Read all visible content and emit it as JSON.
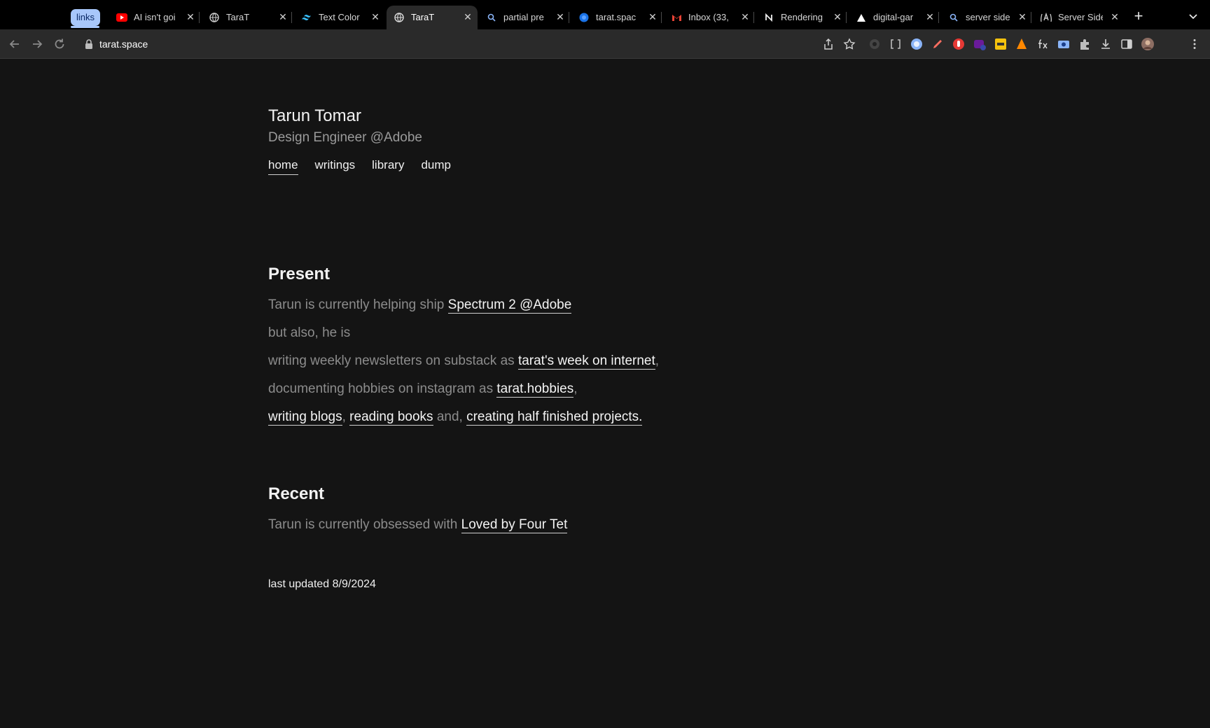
{
  "browser": {
    "tab_group_label": "links",
    "tabs": [
      {
        "title": "AI isn't goi",
        "favicon": "youtube-icon"
      },
      {
        "title": "TaraT",
        "favicon": "globe-icon"
      },
      {
        "title": "Text Color",
        "favicon": "tailwind-icon"
      },
      {
        "title": "TaraT",
        "favicon": "globe-icon",
        "active": true
      },
      {
        "title": "partial pre",
        "favicon": "search-icon"
      },
      {
        "title": "tarat.spac",
        "favicon": "site-icon"
      },
      {
        "title": "Inbox (33,",
        "favicon": "gmail-icon"
      },
      {
        "title": "Rendering",
        "favicon": "notion-icon"
      },
      {
        "title": "digital-gar",
        "favicon": "vercel-icon"
      },
      {
        "title": "server side",
        "favicon": "search-icon"
      },
      {
        "title": "Server Side",
        "favicon": "astro-icon"
      }
    ],
    "url": "tarat.space",
    "colors": {
      "tab_group": "#a8c7fa",
      "chrome_bg": "#000000",
      "toolbar_bg": "#2a2a2a"
    }
  },
  "site": {
    "name": "Tarun Tomar",
    "tagline": "Design Engineer @Adobe",
    "nav": [
      "home",
      "writings",
      "library",
      "dump"
    ],
    "present": {
      "heading": "Present",
      "line1_text": "Tarun is currently helping ship ",
      "line1_link": "Spectrum 2 @Adobe",
      "line2": "but also, he is",
      "line3_text": "writing weekly newsletters on substack as ",
      "line3_link": "tarat's week on internet",
      "line4_text": "documenting hobbies on instagram as ",
      "line4_link": "tarat.hobbies",
      "line5_link1": "writing blogs",
      "line5_link2": "reading books",
      "line5_mid": " and, ",
      "line5_link3": "creating half finished projects."
    },
    "recent": {
      "heading": "Recent",
      "text": "Tarun is currently obsessed with ",
      "link": "Loved by Four Tet"
    },
    "last_updated": "last updated 8/9/2024"
  }
}
